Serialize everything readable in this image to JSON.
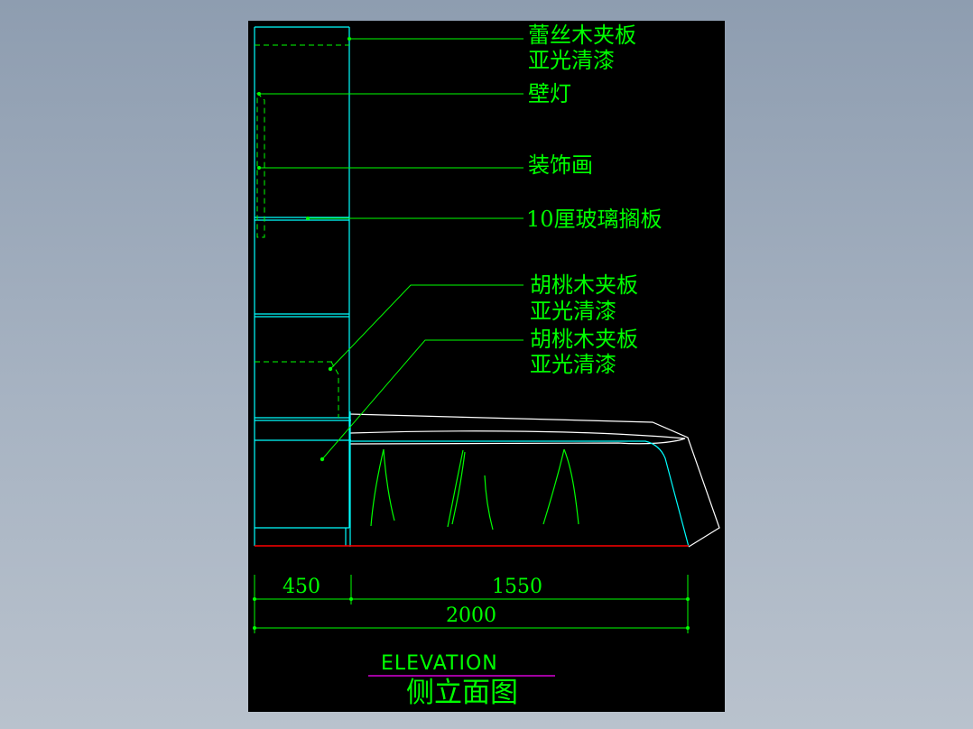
{
  "labels": {
    "lace_wood_line1": "蕾丝木夹板",
    "lace_wood_line2": "亚光清漆",
    "wall_lamp": "壁灯",
    "decorative_painting": "装饰画",
    "glass_shelf": "10厘玻璃搁板",
    "walnut_upper_line1": "胡桃木夹板",
    "walnut_upper_line2": "亚光清漆",
    "walnut_lower_line1": "胡桃木夹板",
    "walnut_lower_line2": "亚光清漆"
  },
  "dimensions": {
    "left": "450",
    "right": "1550",
    "total": "2000"
  },
  "caption": {
    "english": "ELEVATION",
    "chinese": "侧立面图"
  },
  "colors": {
    "background": "#000000",
    "outline": "#00ffff",
    "text": "#00ff00",
    "floor_line": "#ff0000",
    "underline": "#ff00ff",
    "frame": "#ffffff"
  }
}
